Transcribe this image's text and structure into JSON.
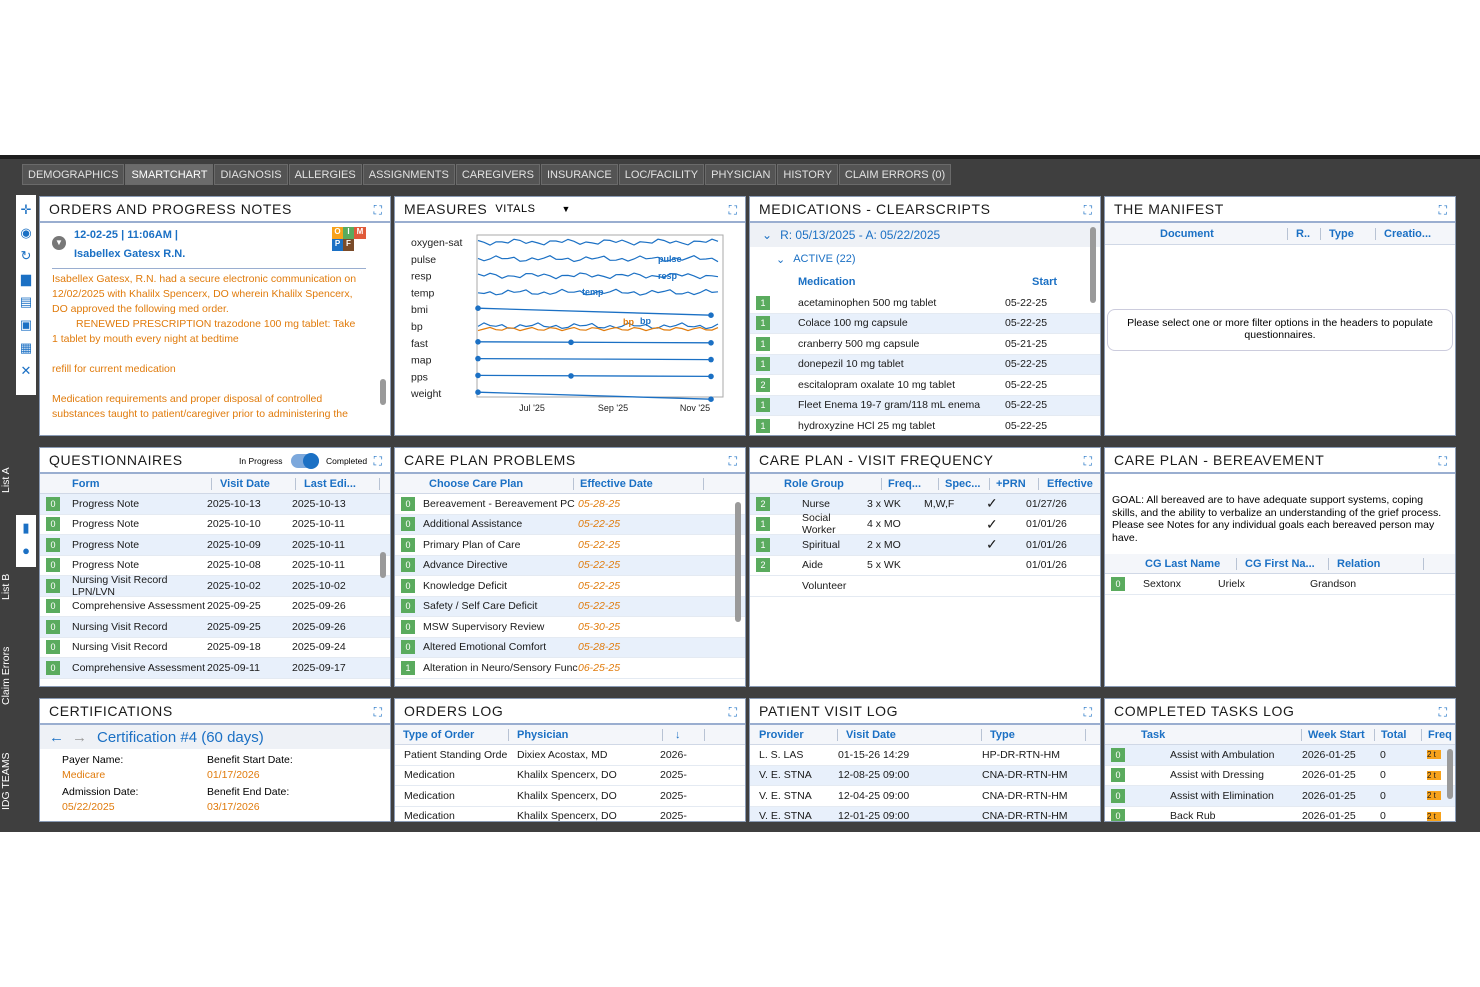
{
  "tabs": [
    "DEMOGRAPHICS",
    "SMARTCHART",
    "DIAGNOSIS",
    "ALLERGIES",
    "ASSIGNMENTS",
    "CAREGIVERS",
    "INSURANCE",
    "LOC/FACILITY",
    "PHYSICIAN",
    "HISTORY",
    "CLAIM ERRORS (0)"
  ],
  "side_labels": {
    "list_a": "List A",
    "list_b": "List B",
    "claim_errors": "Claim Errors",
    "idg_teams": "IDG TEAMS"
  },
  "orders": {
    "title": "ORDERS AND PROGRESS NOTES",
    "date": "12-02-25 | 11:06AM |",
    "author": "Isabellex Gatesx R.N.",
    "logo": [
      "O",
      "I",
      "M",
      "P",
      "F"
    ],
    "body1": "Isabellex Gatesx, R.N. had a secure electronic communication on 12/02/2025 with Khalilx Spencerx,  DO wherein Khalilx Spencerx, DO approved the following med order.",
    "body2": "RENEWED PRESCRIPTION trazodone 100 mg tablet: Take 1 tablet by mouth every night at bedtime",
    "body3": "refill for current medication",
    "body4": "Medication requirements and proper disposal of controlled substances taught to patient/caregiver prior to administering the"
  },
  "measures": {
    "title": "MEASURES",
    "dropdown": "VITALS",
    "labels": [
      "oxygen-sat",
      "pulse",
      "resp",
      "temp",
      "bmi",
      "bp",
      "fast",
      "map",
      "pps",
      "weight"
    ],
    "inline": [
      "pulse",
      "resp",
      "temp",
      "bp",
      "bp"
    ],
    "xticks": [
      "Jul '25",
      "Sep '25",
      "Nov '25"
    ]
  },
  "meds": {
    "title": "MEDICATIONS - CLEARSCRIPTS",
    "range": "R: 05/13/2025 - A: 05/22/2025",
    "active": "ACTIVE (22)",
    "col_med": "Medication",
    "col_start": "Start",
    "rows": [
      [
        "1",
        "acetaminophen 500 mg tablet",
        "05-22-25"
      ],
      [
        "1",
        "Colace 100 mg capsule",
        "05-22-25"
      ],
      [
        "1",
        "cranberry 500 mg capsule",
        "05-21-25"
      ],
      [
        "1",
        "donepezil 10 mg tablet",
        "05-22-25"
      ],
      [
        "2",
        "escitalopram oxalate 10 mg tablet",
        "05-22-25"
      ],
      [
        "1",
        "Fleet Enema 19-7 gram/118 mL enema",
        "05-22-25"
      ],
      [
        "1",
        "hydroxyzine HCl 25 mg tablet",
        "05-22-25"
      ]
    ]
  },
  "manifest": {
    "title": "THE MANIFEST",
    "cols": [
      "Document",
      "R..",
      "Type",
      "Creatio..."
    ],
    "message": "Please select one or more filter options in the headers to populate questionnaires."
  },
  "quest": {
    "title": "QUESTIONNAIRES",
    "toggle_left": "In Progress",
    "toggle_right": "Completed",
    "cols": [
      "Form",
      "Visit Date",
      "Last Edi..."
    ],
    "rows": [
      [
        "0",
        "Progress Note",
        "2025-10-13",
        "2025-10-13"
      ],
      [
        "0",
        "Progress Note",
        "2025-10-10",
        "2025-10-11"
      ],
      [
        "0",
        "Progress Note",
        "2025-10-09",
        "2025-10-11"
      ],
      [
        "0",
        "Progress Note",
        "2025-10-08",
        "2025-10-11"
      ],
      [
        "0",
        "Nursing Visit Record LPN/LVN",
        "2025-10-02",
        "2025-10-02"
      ],
      [
        "0",
        "Comprehensive Assessment",
        "2025-09-25",
        "2025-09-26"
      ],
      [
        "0",
        "Nursing Visit Record",
        "2025-09-25",
        "2025-09-26"
      ],
      [
        "0",
        "Nursing Visit Record",
        "2025-09-18",
        "2025-09-24"
      ],
      [
        "0",
        "Comprehensive Assessment",
        "2025-09-11",
        "2025-09-17"
      ]
    ]
  },
  "cpp": {
    "title": "CARE PLAN PROBLEMS",
    "cols": [
      "Choose Care Plan",
      "Effective Date"
    ],
    "rows": [
      [
        "0",
        "Bereavement - Bereavement PC",
        "05-28-25"
      ],
      [
        "0",
        "Additional Assistance",
        "05-22-25"
      ],
      [
        "0",
        "Primary Plan of Care",
        "05-22-25"
      ],
      [
        "0",
        "Advance Directive",
        "05-22-25"
      ],
      [
        "0",
        "Knowledge Deficit",
        "05-22-25"
      ],
      [
        "0",
        "Safety / Self Care Deficit",
        "05-22-25"
      ],
      [
        "0",
        "MSW Supervisory Review",
        "05-30-25"
      ],
      [
        "0",
        "Altered Emotional Comfort",
        "05-28-25"
      ],
      [
        "1",
        "Alteration in Neuro/Sensory Func",
        "06-25-25"
      ]
    ]
  },
  "cpvf": {
    "title": "CARE PLAN - VISIT FREQUENCY",
    "cols": [
      "Role Group",
      "Freq...",
      "Spec...",
      "+PRN",
      "Effective"
    ],
    "rows": [
      [
        "2",
        "Nurse",
        "3 x WK",
        "M,W,F",
        "✓",
        "01/27/26"
      ],
      [
        "1",
        "Social Worker",
        "4 x MO",
        "",
        "✓",
        "01/01/26"
      ],
      [
        "1",
        "Spiritual",
        "2 x MO",
        "",
        "✓",
        "01/01/26"
      ],
      [
        "2",
        "Aide",
        "5 x WK",
        "",
        "",
        "01/01/26"
      ],
      [
        "",
        "Volunteer",
        "",
        "",
        "",
        ""
      ]
    ]
  },
  "cpb": {
    "title": "CARE PLAN - BEREAVEMENT",
    "goal": "GOAL: All bereaved are to have adequate support systems, coping skills, and the ability to verbalize an understanding of the grief process. Please see Notes for any individual goals each bereaved person may have.",
    "cols": [
      "CG Last Name",
      "CG First Na...",
      "Relation"
    ],
    "rows": [
      [
        "0",
        "Sextonx",
        "Urielx",
        "Grandson"
      ]
    ]
  },
  "cert": {
    "title": "CERTIFICATIONS",
    "cert_name": "Certification #4 (60 days)",
    "payer_label": "Payer Name:",
    "payer": "Medicare",
    "bsd_label": "Benefit Start Date:",
    "bsd": "01/17/2026",
    "adm_label": "Admission Date:",
    "adm": "05/22/2025",
    "bed_label": "Benefit End Date:",
    "bed": "03/17/2026"
  },
  "olog": {
    "title": "ORDERS LOG",
    "cols": [
      "Type of Order",
      "Physician",
      "↓"
    ],
    "rows": [
      [
        "Patient Standing Orde",
        "Dixiex Acostax, MD",
        "2026-"
      ],
      [
        "Medication",
        "Khalilx Spencerx, DO",
        "2025-"
      ],
      [
        "Medication",
        "Khalilx Spencerx, DO",
        "2025-"
      ],
      [
        "Medication",
        "Khalilx Spencerx, DO",
        "2025-"
      ]
    ]
  },
  "pvl": {
    "title": "PATIENT VISIT LOG",
    "cols": [
      "Provider",
      "Visit Date",
      "Type"
    ],
    "rows": [
      [
        "L. S. LAS",
        "01-15-26 14:29",
        "HP-DR-RTN-HM"
      ],
      [
        "V. E. STNA",
        "12-08-25 09:00",
        "CNA-DR-RTN-HM"
      ],
      [
        "V. E. STNA",
        "12-04-25 09:00",
        "CNA-DR-RTN-HM"
      ],
      [
        "V. E. STNA",
        "12-01-25 09:00",
        "CNA-DR-RTN-HM"
      ]
    ]
  },
  "ctl": {
    "title": "COMPLETED TASKS LOG",
    "cols": [
      "Task",
      "Week Start",
      "Total",
      "Freq"
    ],
    "rows": [
      [
        "0",
        "Assist with Ambulation",
        "2026-01-25",
        "0",
        "2 t"
      ],
      [
        "0",
        "Assist with Dressing",
        "2026-01-25",
        "0",
        "2 t"
      ],
      [
        "0",
        "Assist with Elimination",
        "2026-01-25",
        "0",
        "2 t"
      ],
      [
        "0",
        "Back Rub",
        "2026-01-25",
        "0",
        "2 t"
      ]
    ]
  }
}
